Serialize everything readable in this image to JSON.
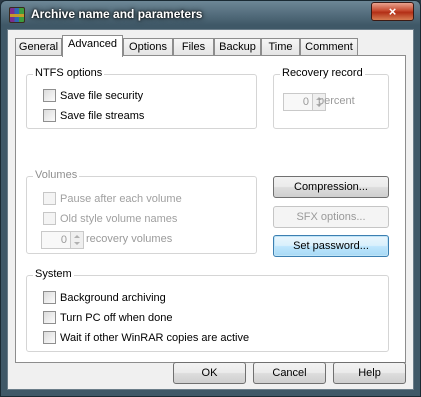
{
  "window": {
    "title": "Archive name and parameters",
    "close_glyph": "×"
  },
  "tabs": [
    {
      "label": "General"
    },
    {
      "label": "Advanced"
    },
    {
      "label": "Options"
    },
    {
      "label": "Files"
    },
    {
      "label": "Backup"
    },
    {
      "label": "Time"
    },
    {
      "label": "Comment"
    }
  ],
  "active_tab": "Advanced",
  "ntfs": {
    "title": "NTFS options",
    "save_security": {
      "label": "Save file security",
      "checked": false
    },
    "save_streams": {
      "label": "Save file streams",
      "checked": false
    }
  },
  "recovery_record": {
    "title": "Recovery record",
    "value": "0",
    "unit": "percent",
    "enabled": false
  },
  "volumes": {
    "title": "Volumes",
    "pause": {
      "label": "Pause after each volume",
      "checked": false,
      "enabled": false
    },
    "old_style": {
      "label": "Old style volume names",
      "checked": false,
      "enabled": false
    },
    "recovery_volumes": {
      "value": "0",
      "label": "recovery volumes",
      "enabled": false
    }
  },
  "side_buttons": {
    "compression": {
      "label": "Compression...",
      "enabled": true
    },
    "sfx": {
      "label": "SFX options...",
      "enabled": false
    },
    "password": {
      "label": "Set password...",
      "enabled": true
    }
  },
  "system": {
    "title": "System",
    "background": {
      "label": "Background archiving",
      "checked": false
    },
    "turn_off": {
      "label": "Turn PC off when done",
      "checked": false
    },
    "wait": {
      "label": "Wait if other WinRAR copies are active",
      "checked": false
    }
  },
  "footer": {
    "ok": "OK",
    "cancel": "Cancel",
    "help": "Help"
  },
  "icons": {
    "app": "winrar-archive-icon",
    "close": "close-icon"
  },
  "colors": {
    "title_bar": "#3f5867",
    "close_button": "#c64a2f",
    "focus_border": "#3c7fb1"
  }
}
